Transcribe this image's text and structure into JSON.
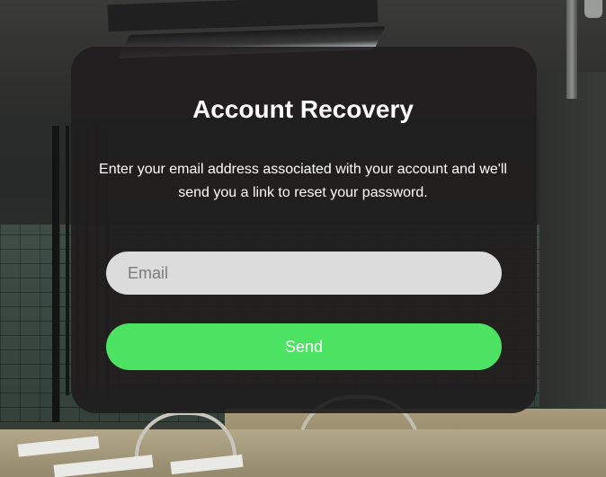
{
  "recovery": {
    "title": "Account Recovery",
    "description": "Enter your email address associated with your account and we'll send you a link to reset your password.",
    "email_placeholder": "Email",
    "email_value": "",
    "send_label": "Send"
  },
  "colors": {
    "accent": "#4ce362",
    "card_background": "#201e1e",
    "input_background": "#dcdcdc"
  }
}
